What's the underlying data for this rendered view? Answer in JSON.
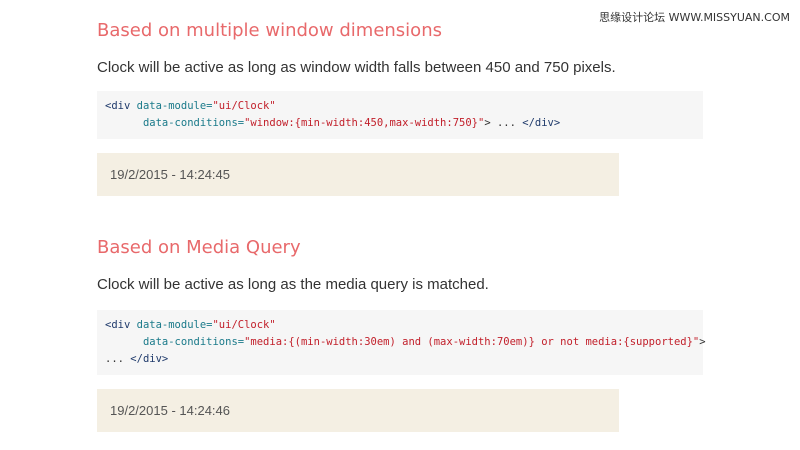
{
  "watermark": "思缘设计论坛 WWW.MISSYUAN.COM",
  "sections": [
    {
      "heading": "Based on multiple window dimensions",
      "description": "Clock will be active as long as window width falls between 450 and 750 pixels.",
      "code": {
        "line1_tag_open": "<div",
        "line1_attr": "data-module=",
        "line1_val": "\"ui/Clock\"",
        "line2_attr": "data-conditions=",
        "line2_val": "\"window:{min-width:450,max-width:750}\"",
        "line2_rest": "> ... ",
        "line2_tag_close": "</div>"
      },
      "clock": "19/2/2015 - 14:24:45"
    },
    {
      "heading": "Based on Media Query",
      "description": "Clock will be active as long as the media query is matched.",
      "code": {
        "line1_tag_open": "<div",
        "line1_attr": "data-module=",
        "line1_val": "\"ui/Clock\"",
        "line2_attr": "data-conditions=",
        "line2_val": "\"media:{(min-width:30em) and (max-width:70em)} or not media:{supported}\"",
        "line2_rest": ">",
        "line3_rest": "... ",
        "line3_tag_close": "</div>"
      },
      "clock": "19/2/2015 - 14:24:46"
    }
  ]
}
